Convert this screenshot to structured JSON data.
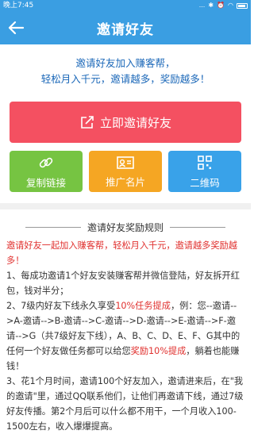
{
  "status_bar": {
    "time": "晚上7:45",
    "signal_text": "...",
    "icons": [
      "bluetooth-icon",
      "alarm-icon",
      "wifi-icon",
      "battery-icon"
    ]
  },
  "header": {
    "title": "邀请好友"
  },
  "intro": {
    "line1": "邀请好友加入赚客帮，",
    "line2": "轻松月入千元，邀请越多，奖励越多！"
  },
  "invite_button": {
    "label": "立即邀请好友"
  },
  "tiles": [
    {
      "label": "复制链接",
      "icon": "link-icon"
    },
    {
      "label": "推广名片",
      "icon": "id-card-icon"
    },
    {
      "label": "二维码",
      "icon": "qr-code-icon"
    }
  ],
  "rules": {
    "heading": "邀请好友奖励规则",
    "lead": "邀请好友一起加入赚客帮，轻松月入千元，邀请越多奖励越多！",
    "rule1": "1、每成功邀请1个好友安装赚客帮并微信登陆，好友拆开红包，钱对半分；",
    "rule2_a": "2、7级内好友下线永久享受",
    "rule2_b": "10%任务提成",
    "rule2_c": "，例：您--邀请-->A-邀请-->B-邀请-->C-邀请-->D-邀请-->E-邀请-->F-邀请-->G（共7级好友下线），A、B、C、D、E、F、G其中的任何一个好友做任务都可以给您",
    "rule2_d": "奖励10%提成",
    "rule2_e": "，躺着也能赚钱！",
    "rule3": "3、花1个月时间，邀请100个好友加入，邀请进来后，在\"我的邀请\"里，通过QQ联系他们，让他们再邀请下线，通过7级好友传播。第2个月后可以什么都不用干，一个月收入100-1500左右，收入爆爆提高。"
  },
  "colors": {
    "primary": "#3a9ee2",
    "invite": "#f45061",
    "green": "#76c442",
    "orange": "#f5a623",
    "blue": "#39a2e9",
    "highlight_red": "#e0302e",
    "intro_blue": "#1a67b8"
  }
}
